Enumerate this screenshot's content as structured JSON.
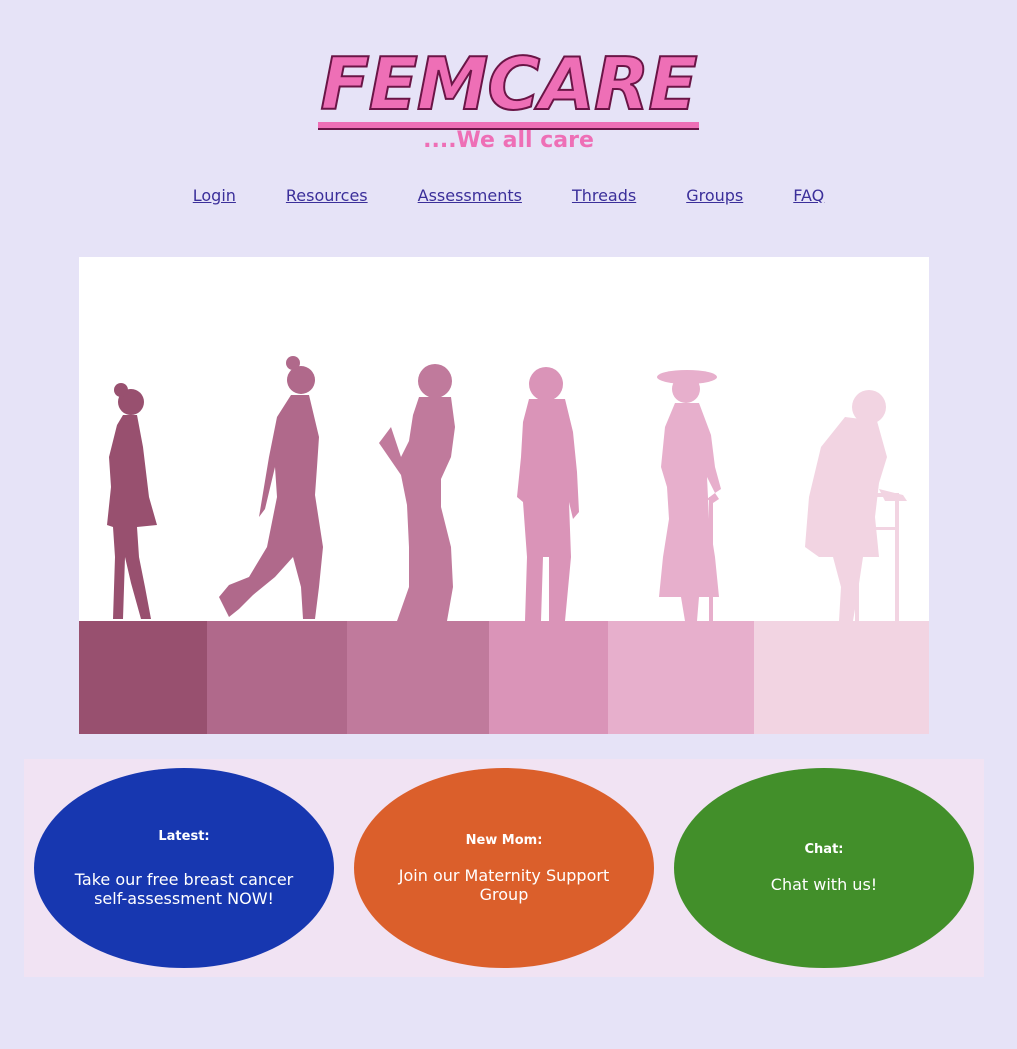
{
  "brand": {
    "logo_text": "FEMCARE",
    "tagline": "....We all care"
  },
  "nav": {
    "items": [
      "Login",
      "Resources",
      "Assessments",
      "Threads",
      "Groups",
      "FAQ"
    ]
  },
  "hero": {
    "floor_colors": [
      "#98506f",
      "#b0698b",
      "#c07a9c",
      "#da94b8",
      "#e7afcc",
      "#f2d4e2"
    ]
  },
  "cards": [
    {
      "title": "Latest:",
      "body": "Take our free breast cancer self-assessment NOW!",
      "color": "#1737b0"
    },
    {
      "title": "New Mom:",
      "body": "Join our Maternity Support Group",
      "color": "#db5f2b"
    },
    {
      "title": "Chat:",
      "body": "Chat with us!",
      "color": "#428f2a"
    }
  ],
  "colors": {
    "page_bg": "#e6e3f7",
    "accent": "#ee6fb6",
    "link": "#3b2f9a"
  }
}
